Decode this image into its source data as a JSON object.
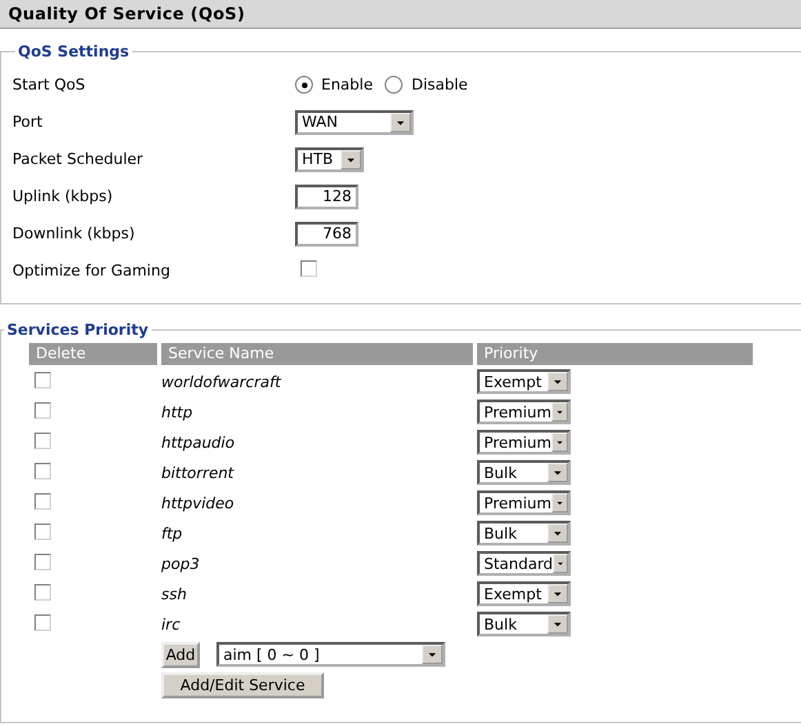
{
  "title": "Quality Of Service (QoS)",
  "qos_settings": {
    "legend": "QoS Settings",
    "start_qos": {
      "label": "Start QoS",
      "options": [
        {
          "label": "Enable",
          "selected": true
        },
        {
          "label": "Disable",
          "selected": false
        }
      ]
    },
    "port": {
      "label": "Port",
      "value": "WAN"
    },
    "packet_scheduler": {
      "label": "Packet Scheduler",
      "value": "HTB"
    },
    "uplink": {
      "label": "Uplink (kbps)",
      "value": "128"
    },
    "downlink": {
      "label": "Downlink (kbps)",
      "value": "768"
    },
    "optimize_for_gaming": {
      "label": "Optimize for Gaming",
      "checked": false
    }
  },
  "services_priority": {
    "legend": "Services Priority",
    "columns": [
      "Delete",
      "Service Name",
      "Priority"
    ],
    "rows": [
      {
        "delete": false,
        "name": "worldofwarcraft",
        "priority": "Exempt"
      },
      {
        "delete": false,
        "name": "http",
        "priority": "Premium"
      },
      {
        "delete": false,
        "name": "httpaudio",
        "priority": "Premium"
      },
      {
        "delete": false,
        "name": "bittorrent",
        "priority": "Bulk"
      },
      {
        "delete": false,
        "name": "httpvideo",
        "priority": "Premium"
      },
      {
        "delete": false,
        "name": "ftp",
        "priority": "Bulk"
      },
      {
        "delete": false,
        "name": "pop3",
        "priority": "Standard"
      },
      {
        "delete": false,
        "name": "ssh",
        "priority": "Exempt"
      },
      {
        "delete": false,
        "name": "irc",
        "priority": "Bulk"
      }
    ],
    "add_button": "Add",
    "service_select": "aim [ 0 ~ 0 ]",
    "add_edit_button": "Add/Edit Service"
  }
}
